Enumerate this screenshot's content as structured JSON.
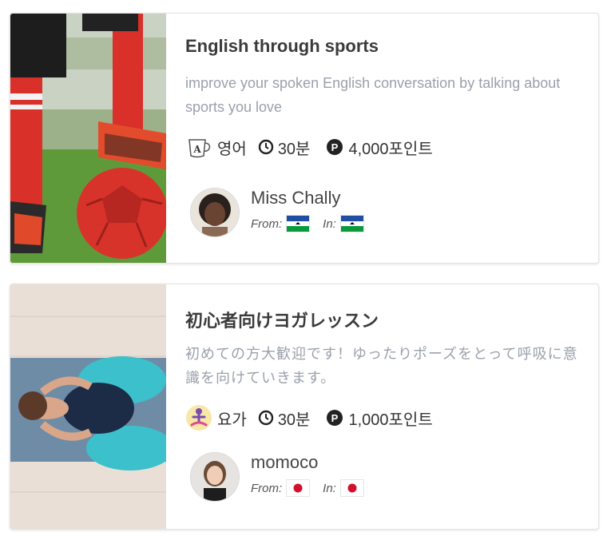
{
  "lessons": [
    {
      "title": "English through sports",
      "description": "improve your spoken English conversation by talking about sports you love",
      "category_icon": "coffee-cup-letter-a-icon",
      "category": "영어",
      "duration": "30분",
      "points": "4,000포인트",
      "teacher": {
        "name": "Miss Chally",
        "from_label": "From:",
        "in_label": "In:",
        "from_flag": "lesotho-flag-icon",
        "in_flag": "lesotho-flag-icon"
      }
    },
    {
      "title": "初心者向けヨガレッスン",
      "description": "初めての方大歓迎です！ゆったりポーズをとって呼吸に意識を向けていきます。",
      "category_icon": "yoga-pose-icon",
      "category": "요가",
      "duration": "30분",
      "points": "1,000포인트",
      "teacher": {
        "name": "momoco",
        "from_label": "From:",
        "in_label": "In:",
        "from_flag": "japan-flag-icon",
        "in_flag": "japan-flag-icon"
      }
    }
  ],
  "colors": {
    "title": "#3b3b3b",
    "description": "#9aa0ab",
    "text": "#333333"
  }
}
